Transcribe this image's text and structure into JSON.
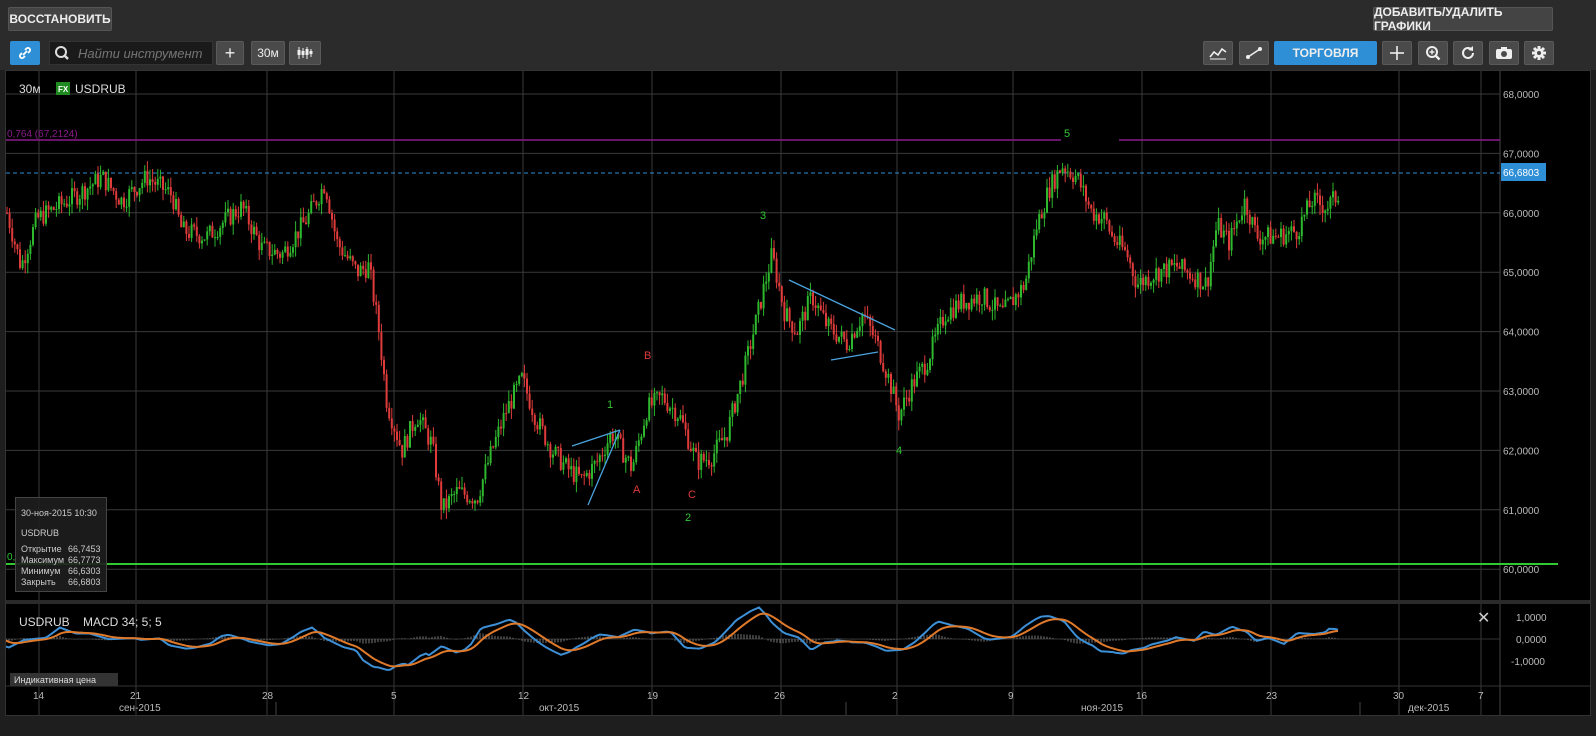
{
  "top": {
    "restore_label": "ВОССТАНОВИТЬ",
    "add_remove_label": "ДОБАВИТЬ/УДАЛИТЬ ГРАФИКИ"
  },
  "toolbar": {
    "search_placeholder": "Найти инструмент",
    "add_label": "+",
    "interval_label": "30м",
    "trade_label": "ТОРГОВЛЯ"
  },
  "chart": {
    "interval": "30м",
    "fx_badge": "FX",
    "symbol": "USDRUB",
    "fib_label": "0,764 (67,2124)",
    "fib_low_label": "0,",
    "current_price": "66,6803",
    "price_ticks": [
      "68,0000",
      "67,0000",
      "66,0000",
      "65,0000",
      "64,0000",
      "63,0000",
      "62,0000",
      "61,0000",
      "60,0000"
    ],
    "wave_labels": [
      "5",
      "3",
      "B",
      "1",
      "A",
      "C",
      "2",
      "4"
    ],
    "day_ticks": [
      "14",
      "21",
      "28",
      "5",
      "12",
      "19",
      "26",
      "2",
      "9",
      "16",
      "23",
      "30",
      "7"
    ],
    "month_labels": [
      "сен-2015",
      "окт-2015",
      "ноя-2015",
      "дек-2015"
    ]
  },
  "tooltip": {
    "datetime": "30-ноя-2015 10:30",
    "symbol": "USDRUB",
    "rows": [
      {
        "label": "Открытие",
        "value": "66,7453"
      },
      {
        "label": "Максимум",
        "value": "66,7773"
      },
      {
        "label": "Минимум",
        "value": "66,6303"
      },
      {
        "label": "Закрыть",
        "value": "66,6803"
      }
    ]
  },
  "macd": {
    "symbol": "USDRUB",
    "title": "MACD 34; 5; 5",
    "ticks": [
      "1,0000",
      "0,0000",
      "-1,0000"
    ],
    "footer": "Индикативная цена"
  },
  "colors": {
    "up": "#2db82d",
    "down": "#e03b3b",
    "accent": "#2e8fd6",
    "fib": "#8b1a8b",
    "support": "#31c831"
  }
}
